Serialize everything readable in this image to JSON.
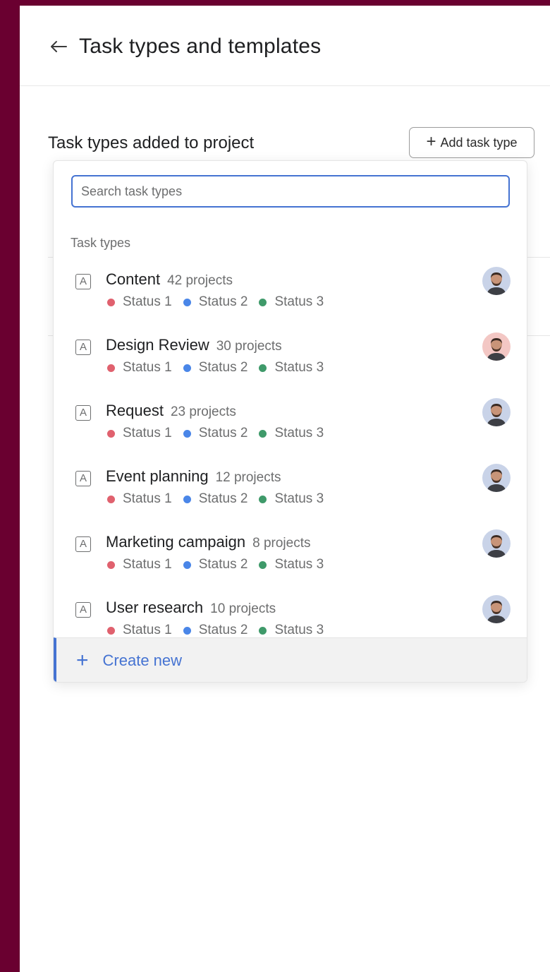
{
  "header": {
    "title": "Task types and templates",
    "back_icon": "arrow-left-icon"
  },
  "section": {
    "title": "Task types added to project",
    "add_button_label": "Add task type"
  },
  "dropdown": {
    "search_placeholder": "Search task types",
    "search_value": "",
    "group_label": "Task types",
    "create_label": "Create new"
  },
  "status_colors": {
    "status_1": "#e0616e",
    "status_2": "#4a86e8",
    "status_3": "#3f9a6a"
  },
  "accent_color": "#4573d2",
  "task_types": [
    {
      "icon": "A",
      "name": "Content",
      "count": "42 projects",
      "statuses": [
        "Status 1",
        "Status 2",
        "Status 3"
      ],
      "avatar_bg": "#c9d3e8"
    },
    {
      "icon": "A",
      "name": "Design Review",
      "count": "30 projects",
      "statuses": [
        "Status 1",
        "Status 2",
        "Status 3"
      ],
      "avatar_bg": "#f3c7c4"
    },
    {
      "icon": "A",
      "name": "Request",
      "count": "23 projects",
      "statuses": [
        "Status 1",
        "Status 2",
        "Status 3"
      ],
      "avatar_bg": "#c9d3e8"
    },
    {
      "icon": "A",
      "name": "Event planning",
      "count": "12 projects",
      "statuses": [
        "Status 1",
        "Status 2",
        "Status 3"
      ],
      "avatar_bg": "#c9d3e8"
    },
    {
      "icon": "A",
      "name": "Marketing campaign",
      "count": "8 projects",
      "statuses": [
        "Status 1",
        "Status 2",
        "Status 3"
      ],
      "avatar_bg": "#c9d3e8"
    },
    {
      "icon": "A",
      "name": "User research",
      "count": "10 projects",
      "statuses": [
        "Status 1",
        "Status 2",
        "Status 3"
      ],
      "avatar_bg": "#c9d3e8"
    }
  ]
}
